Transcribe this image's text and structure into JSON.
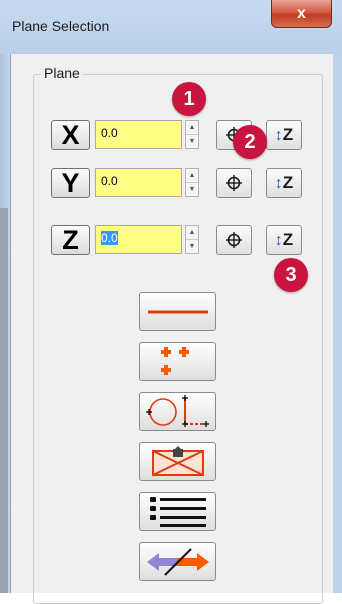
{
  "window": {
    "title": "Plane Selection",
    "close_symbol": "x"
  },
  "group": {
    "label": "Plane"
  },
  "axes": [
    {
      "label": "X",
      "value": "0.0",
      "selected": false
    },
    {
      "label": "Y",
      "value": "0.0",
      "selected": false
    },
    {
      "label": "Z",
      "value": "0.0",
      "selected": true
    }
  ],
  "spinner": {
    "up": "▲",
    "down": "▼"
  },
  "tools": {
    "z_icon_text": "Z",
    "z_arrow": "↕",
    "crosshair": "⌖"
  },
  "callouts": [
    "1",
    "2",
    "3"
  ],
  "colors": {
    "field_bg": "#ffff85",
    "accent_red": "#e23b12",
    "callout": "#c8143f",
    "arrow_purple": "#8f86d6"
  },
  "bottom_tools": [
    "line-icon",
    "points-icon",
    "circle-points-icon",
    "box-icon",
    "list-icon",
    "swap-arrow-icon"
  ]
}
